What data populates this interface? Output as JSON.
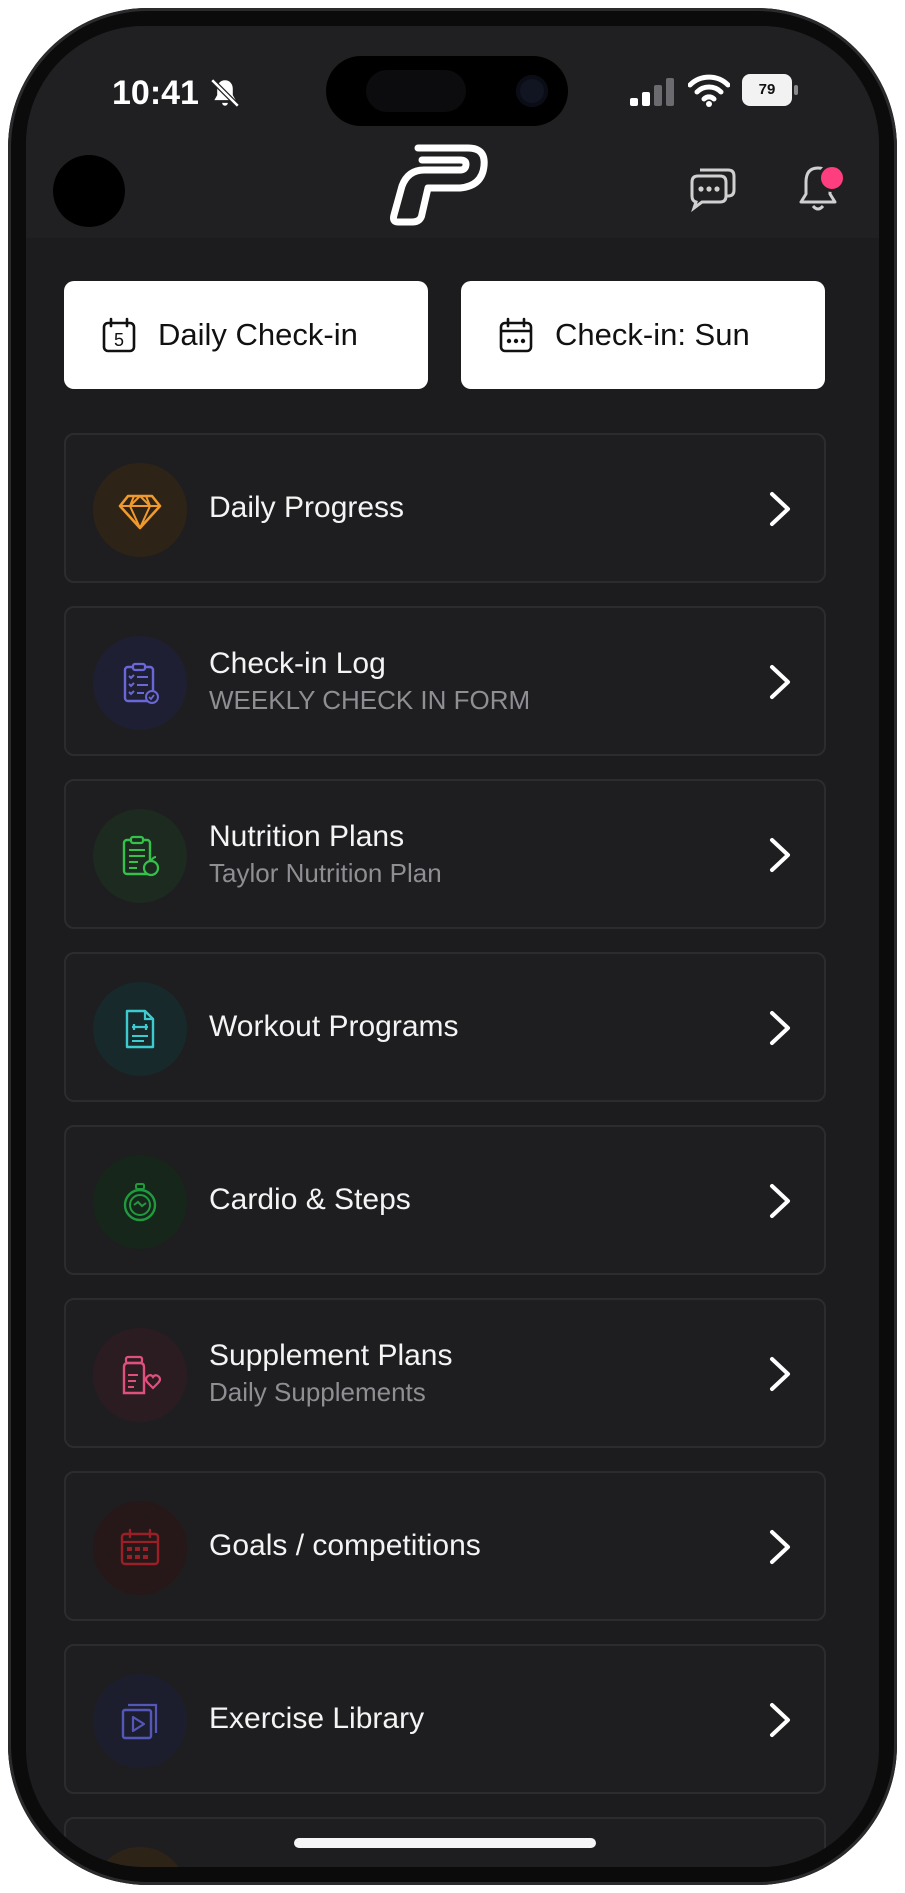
{
  "status_bar": {
    "time": "10:41",
    "battery_level": "79",
    "icons": [
      "bell-slash-icon",
      "cellular-signal-icon",
      "wifi-icon",
      "battery-icon"
    ]
  },
  "header": {
    "logo": "app-logo",
    "icons": [
      "chat-bubbles-icon",
      "notification-bell-icon"
    ],
    "notification_badge_color": "#ff3e7f"
  },
  "checkin_buttons": [
    {
      "label": "Daily Check-in",
      "icon": "calendar-day-5-icon",
      "day_number": "5"
    },
    {
      "label": "Check-in: Sun",
      "icon": "calendar-icon"
    }
  ],
  "menu_items": [
    {
      "title": "Daily Progress",
      "subtitle": "",
      "icon": "diamond-icon",
      "color": "#f09a2e"
    },
    {
      "title": "Check-in Log",
      "subtitle": "WEEKLY CHECK IN FORM",
      "icon": "checklist-clipboard-icon",
      "color": "#6a67d8"
    },
    {
      "title": "Nutrition Plans",
      "subtitle": "Taylor Nutrition Plan",
      "icon": "nutrition-clipboard-icon",
      "color": "#35c24a"
    },
    {
      "title": "Workout Programs",
      "subtitle": "",
      "icon": "workout-document-icon",
      "color": "#3ecbd0"
    },
    {
      "title": "Cardio & Steps",
      "subtitle": "",
      "icon": "stopwatch-icon",
      "color": "#1f9a3e"
    },
    {
      "title": "Supplement Plans",
      "subtitle": "Daily Supplements",
      "icon": "supplement-bottle-icon",
      "color": "#e0507c"
    },
    {
      "title": "Goals / competitions",
      "subtitle": "",
      "icon": "calendar-goals-icon",
      "color": "#9a1f26"
    },
    {
      "title": "Exercise Library",
      "subtitle": "",
      "icon": "video-library-icon",
      "color": "#5456b8"
    }
  ]
}
